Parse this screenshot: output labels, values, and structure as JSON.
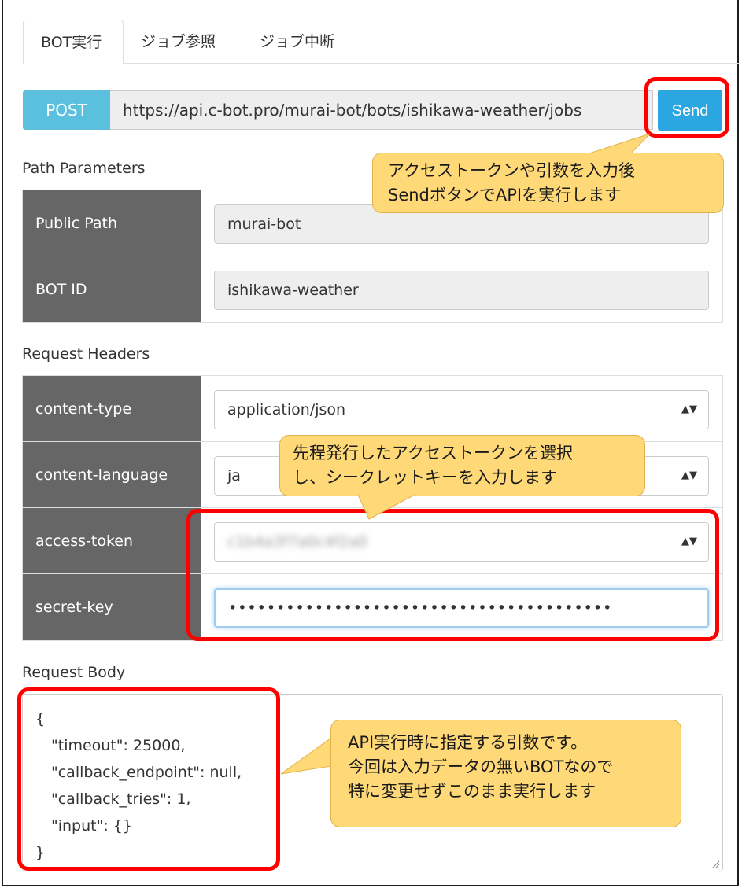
{
  "tabs": [
    {
      "label": "BOT実行",
      "active": true
    },
    {
      "label": "ジョブ参照",
      "active": false
    },
    {
      "label": "ジョブ中断",
      "active": false
    }
  ],
  "request": {
    "method": "POST",
    "url": "https://api.c-bot.pro/murai-bot/bots/ishikawa-weather/jobs",
    "send_label": "Send"
  },
  "path_parameters": {
    "title": "Path Parameters",
    "rows": [
      {
        "name": "Public Path",
        "value": "murai-bot"
      },
      {
        "name": "BOT ID",
        "value": "ishikawa-weather"
      }
    ]
  },
  "request_headers": {
    "title": "Request Headers",
    "rows": [
      {
        "name": "content-type",
        "value": "application/json"
      },
      {
        "name": "content-language",
        "value": "ja"
      },
      {
        "name": "access-token",
        "value": "c1b4a3f7a0c4f2a0"
      },
      {
        "name": "secret-key",
        "value": "••••••••••••••••••••••••••••••••••••••••"
      }
    ]
  },
  "request_body": {
    "title": "Request Body",
    "lines": [
      "{",
      "\"timeout\": 25000,",
      "\"callback_endpoint\": null,",
      "\"callback_tries\": 1,",
      "\"input\": {}",
      "}"
    ]
  },
  "callouts": {
    "send": [
      "アクセストークンや引数を入力後",
      "SendボタンでAPIを実行します"
    ],
    "token": [
      "先程発行したアクセストークンを選択",
      "し、シークレットキーを入力します"
    ],
    "body": [
      "API実行時に指定する引数です。",
      "今回は入力データの無いBOTなので",
      "特に変更せずこのまま実行します"
    ]
  },
  "colors": {
    "method_badge": "#5bc0de",
    "send_button": "#2ba6e1",
    "param_name_bg": "#666666",
    "highlight": "#ff0000",
    "callout_bg": "#ffd978"
  },
  "icons": {
    "select_arrow": "sort-arrows-icon",
    "textarea_grip": "resize-grip-icon"
  }
}
